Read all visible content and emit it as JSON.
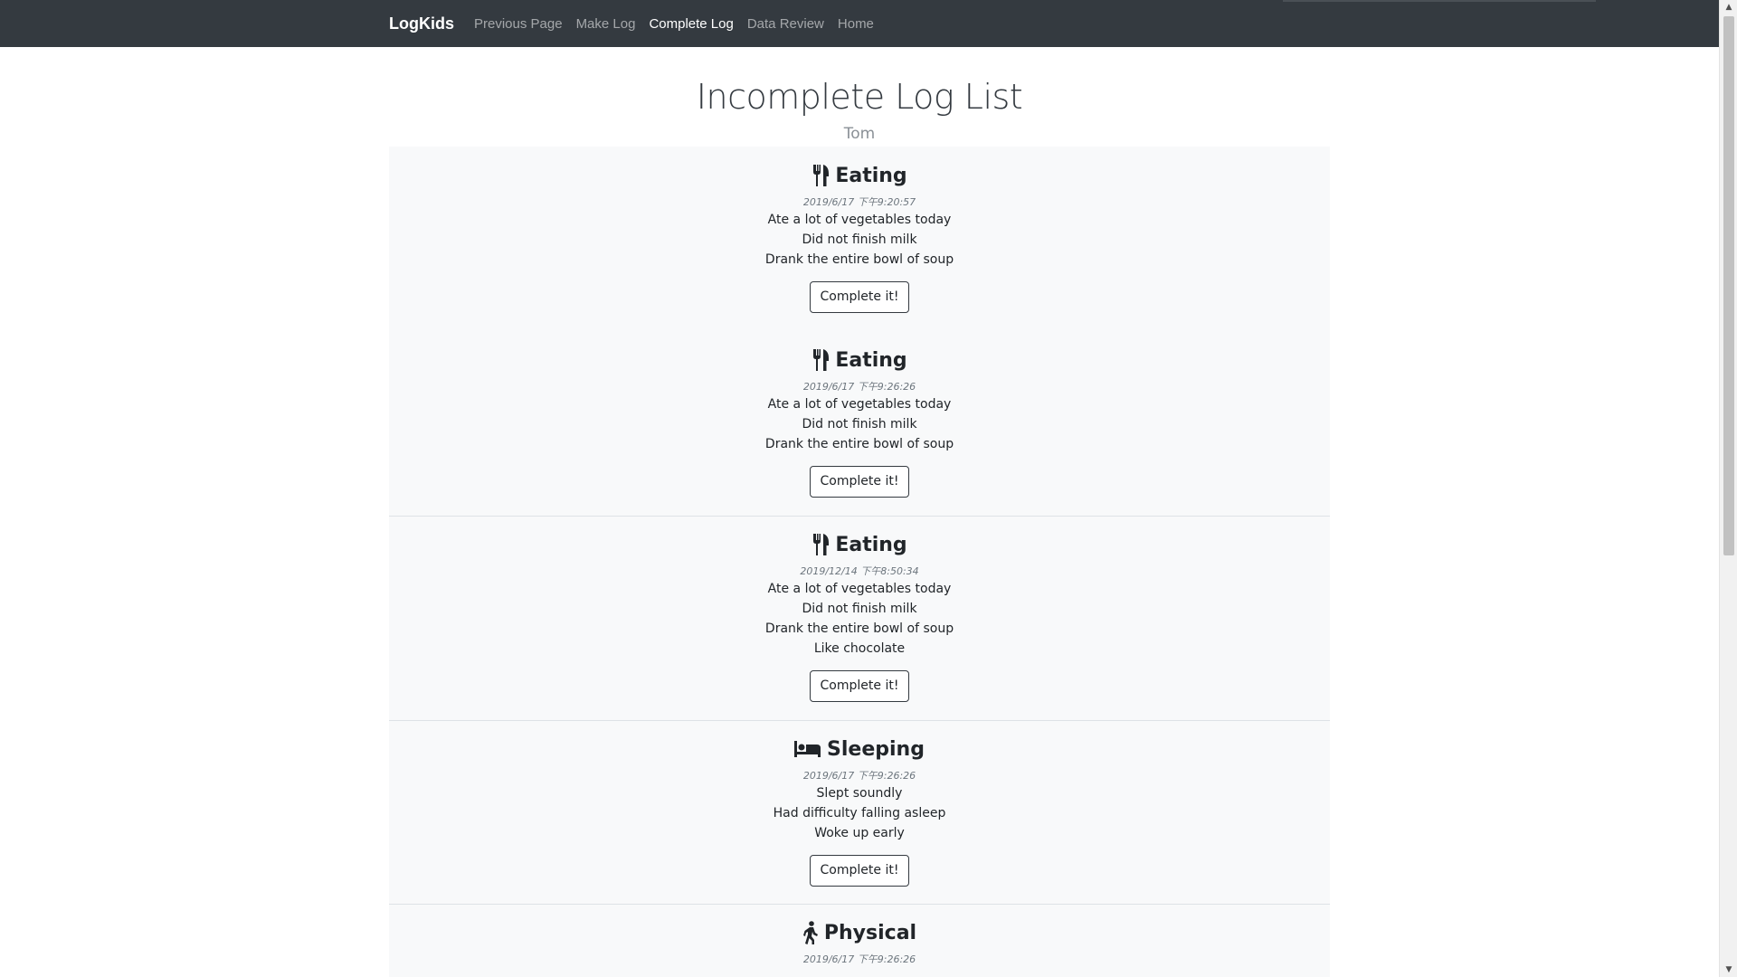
{
  "navbar": {
    "brand": "LogKids",
    "links": [
      {
        "label": "Previous Page",
        "active": false
      },
      {
        "label": "Make Log",
        "active": false
      },
      {
        "label": "Complete Log",
        "active": true
      },
      {
        "label": "Data Review",
        "active": false
      },
      {
        "label": "Home",
        "active": false
      }
    ]
  },
  "page": {
    "title": "Incomplete Log List",
    "subtitle": "Tom"
  },
  "logs": [
    {
      "category": "Eating",
      "icon": "utensils-icon",
      "date": "2019/6/17 下午9:20:57",
      "lines": [
        "Ate a lot of vegetables today",
        "Did not finish milk",
        "Drank the entire bowl of soup"
      ],
      "button": "Complete it!"
    },
    {
      "category": "Eating",
      "icon": "utensils-icon",
      "date": "2019/6/17 下午9:26:26",
      "lines": [
        "Ate a lot of vegetables today",
        "Did not finish milk",
        "Drank the entire bowl of soup"
      ],
      "button": "Complete it!"
    },
    {
      "category": "Eating",
      "icon": "utensils-icon",
      "date": "2019/12/14 下午8:50:34",
      "lines": [
        "Ate a lot of vegetables today",
        "Did not finish milk",
        "Drank the entire bowl of soup",
        "Like chocolate"
      ],
      "button": "Complete it!"
    },
    {
      "category": "Sleeping",
      "icon": "bed-icon",
      "date": "2019/6/17 下午9:26:26",
      "lines": [
        "Slept soundly",
        "Had difficulty falling asleep",
        "Woke up early"
      ],
      "button": "Complete it!"
    },
    {
      "category": "Physical",
      "icon": "walking-icon",
      "date": "2019/6/17 下午9:26:26",
      "lines": [],
      "button": ""
    }
  ],
  "colors": {
    "navbar_bg": "#343a40",
    "item_bg": "#f8f9fa",
    "nav_active": "#ffffff",
    "nav_inactive": "rgba(255,255,255,0.55)"
  }
}
